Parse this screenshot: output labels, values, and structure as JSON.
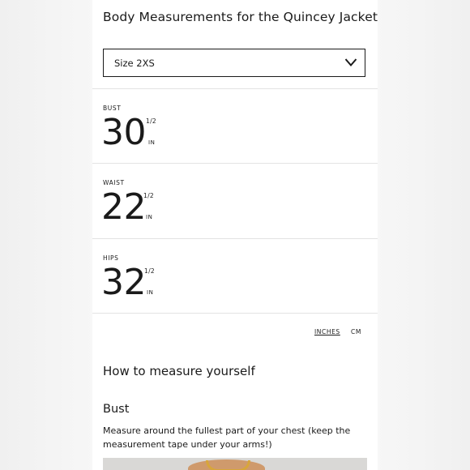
{
  "title": "Body Measurements for the Quincey Jacket",
  "size_select": {
    "value": "Size 2XS",
    "icon": "chevron-down-icon"
  },
  "measurements": [
    {
      "label": "BUST",
      "value": "30",
      "fraction": "1/2",
      "unit": "IN"
    },
    {
      "label": "WAIST",
      "value": "22",
      "fraction": "1/2",
      "unit": "IN"
    },
    {
      "label": "HIPS",
      "value": "32",
      "fraction": "1/2",
      "unit": "IN"
    }
  ],
  "unit_toggle": {
    "inches": "INCHES",
    "cm": "CM",
    "selected": "INCHES"
  },
  "howto": {
    "heading": "How to measure yourself",
    "bust_heading": "Bust",
    "bust_description": "Measure around the fullest part of your chest (keep the measurement tape under your arms!)"
  },
  "colors": {
    "text": "#1a1a1a",
    "divider": "#e3e3e3",
    "background": "#ffffff"
  }
}
